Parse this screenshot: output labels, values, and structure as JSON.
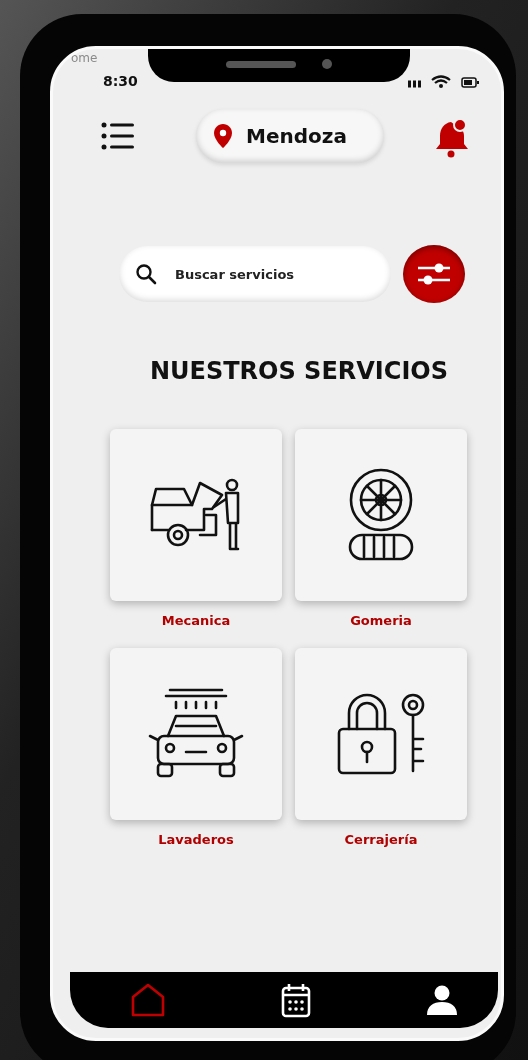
{
  "background_label": "ome",
  "status_bar": {
    "time": "8:30"
  },
  "header": {
    "location": "Mendoza"
  },
  "search": {
    "placeholder": "Buscar servicios"
  },
  "section_title": "NUESTROS SERVICIOS",
  "services": [
    {
      "kind": "mechanic",
      "label": "Mecanica"
    },
    {
      "kind": "tire",
      "label": "Gomeria"
    },
    {
      "kind": "carwash",
      "label": "Lavaderos"
    },
    {
      "kind": "locksmith",
      "label": "Cerrajería"
    }
  ],
  "bottom_nav": [
    {
      "kind": "home",
      "selected": true
    },
    {
      "kind": "calendar",
      "selected": false
    },
    {
      "kind": "profile",
      "selected": false
    }
  ]
}
